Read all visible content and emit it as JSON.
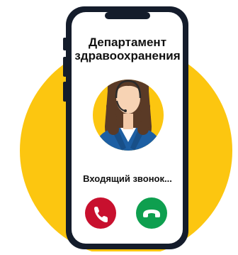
{
  "caller": {
    "name_line1": "Департамент",
    "name_line2": "здравоохранения"
  },
  "call": {
    "status_text": "Входящий звонок..."
  },
  "actions": {
    "decline_color": "#c8102e",
    "accept_color": "#0e9f4f"
  },
  "icons": {
    "decline": "phone-hangup-icon",
    "accept": "phone-answer-icon"
  },
  "colors": {
    "background_circle": "#fcc610",
    "phone_body": "#141c2b",
    "avatar_circle": "#fcc610",
    "jacket": "#1d5fa3",
    "hair": "#5a3a26"
  }
}
